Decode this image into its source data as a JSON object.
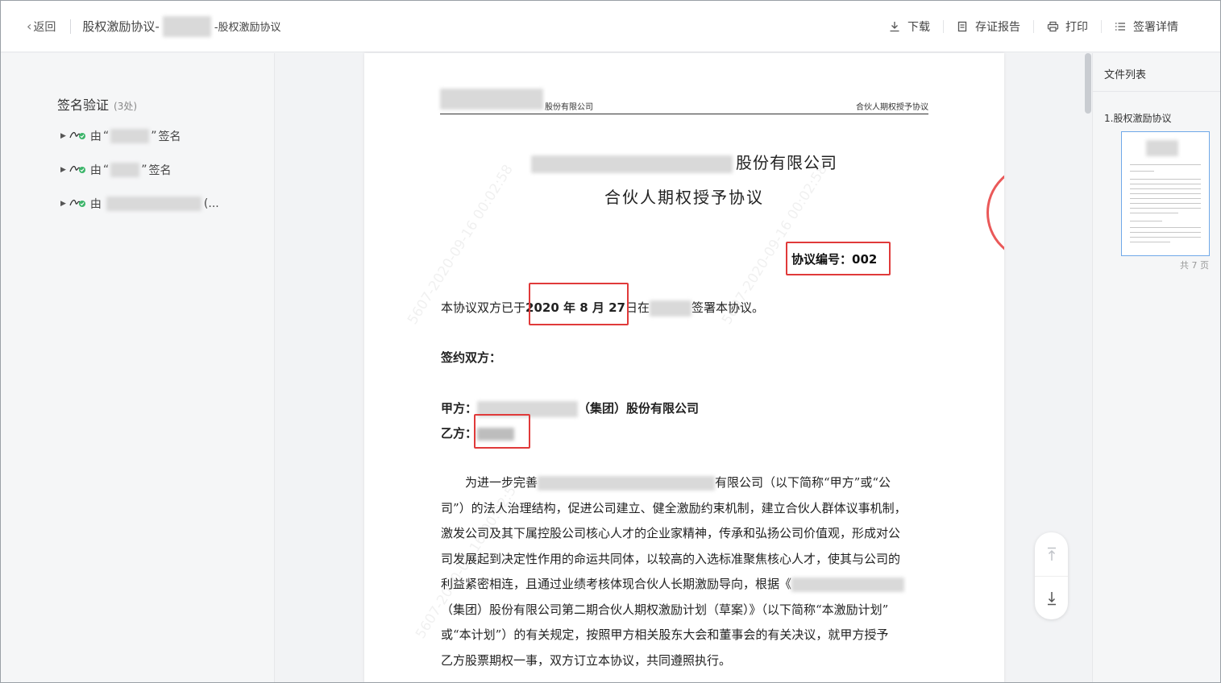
{
  "header": {
    "back_label": "返回",
    "title_prefix": "股权激励协议-",
    "title_suffix": "-股权激励协议",
    "actions": [
      {
        "label": "下载",
        "icon": "download-icon"
      },
      {
        "label": "存证报告",
        "icon": "report-icon"
      },
      {
        "label": "打印",
        "icon": "print-icon"
      },
      {
        "label": "签署详情",
        "icon": "list-icon"
      }
    ]
  },
  "left_panel": {
    "title": "签名验证",
    "count": "(3处)",
    "items": [
      {
        "prefix": "由",
        "quote_open": "“",
        "quote_close": "”",
        "suffix": "签名"
      },
      {
        "prefix": "由",
        "quote_open": "“",
        "quote_close": "”",
        "suffix": "签名"
      },
      {
        "prefix": "由",
        "suffix": "(..."
      }
    ]
  },
  "document": {
    "header_left": "股份有限公司",
    "header_right": "合伙人期权授予协议",
    "company_name": "股份有限公司",
    "title": "合伙人期权授予协议",
    "agreement_no_label": "协议编号：",
    "agreement_no": "002",
    "sign_sentence_pre": "本协议双方已于",
    "sign_date": "2020 年 8 月 27",
    "sign_sentence_mid": "日在",
    "sign_sentence_post": "签署本协议。",
    "parties_label": "签约双方：",
    "party_a_label": "甲方：",
    "party_a_suffix": "（集团）股份有限公司",
    "party_b_label": "乙方：",
    "body_lines": [
      "为进一步完善",
      "有限公司（以下简称“甲方”或“公",
      "司”）的法人治理结构，促进公司建立、健全激励约束机制，建立合伙人群体议事机制，",
      "激发公司及其下属控股公司核心人才的企业家精神，传承和弘扬公司价值观，形成对公",
      "司发展起到决定性作用的命运共同体，以较高的入选标准聚焦核心人才，使其与公司的",
      "利益紧密相连，且通过业绩考核体现合伙人长期激励导向，根据《",
      "（集团）股份有限公司第二期合伙人期权激励计划（草案）》（以下简称“本激励计划”",
      "或“本计划”）的有关规定，按照甲方相关股东大会和董事会的有关决议，就甲方授予",
      "乙方股票期权一事，双方订立本协议，共同遵照执行。"
    ],
    "watermarks": [
      "5607-2020-09-16 00:02:58",
      "5607-2020-09-16 00:02:58",
      "5607-2020-09-16 00:02:58"
    ]
  },
  "right_panel": {
    "title": "文件列表",
    "file_name": "1.股权激励协议",
    "page_count": "共 7 页"
  },
  "colors": {
    "highlight": "#e03a3a",
    "thumb_border": "#6fa8e8"
  }
}
